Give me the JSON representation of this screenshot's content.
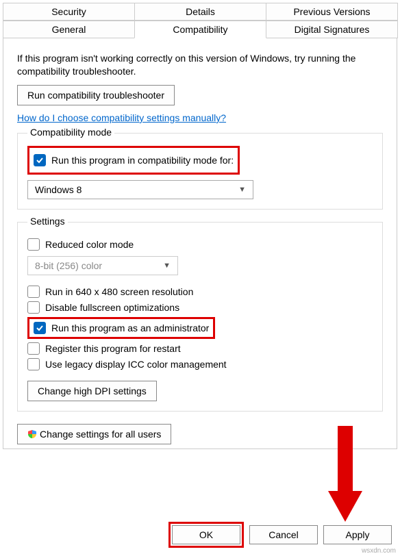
{
  "tabs": {
    "row1": [
      "Security",
      "Details",
      "Previous Versions"
    ],
    "row2": [
      "General",
      "Compatibility",
      "Digital Signatures"
    ],
    "active": "Compatibility"
  },
  "intro": "If this program isn't working correctly on this version of Windows, try running the compatibility troubleshooter.",
  "troubleshoot_btn": "Run compatibility troubleshooter",
  "help_link": "How do I choose compatibility settings manually?",
  "compat_group": {
    "title": "Compatibility mode",
    "checkbox": "Run this program in compatibility mode for:",
    "select": "Windows 8"
  },
  "settings_group": {
    "title": "Settings",
    "reduced_color": "Reduced color mode",
    "color_select": "8-bit (256) color",
    "run_640": "Run in 640 x 480 screen resolution",
    "disable_fullscreen": "Disable fullscreen optimizations",
    "run_admin": "Run this program as an administrator",
    "register_restart": "Register this program for restart",
    "legacy_icc": "Use legacy display ICC color management",
    "dpi_btn": "Change high DPI settings"
  },
  "all_users_btn": "Change settings for all users",
  "footer": {
    "ok": "OK",
    "cancel": "Cancel",
    "apply": "Apply"
  },
  "watermark": "wsxdn.com"
}
